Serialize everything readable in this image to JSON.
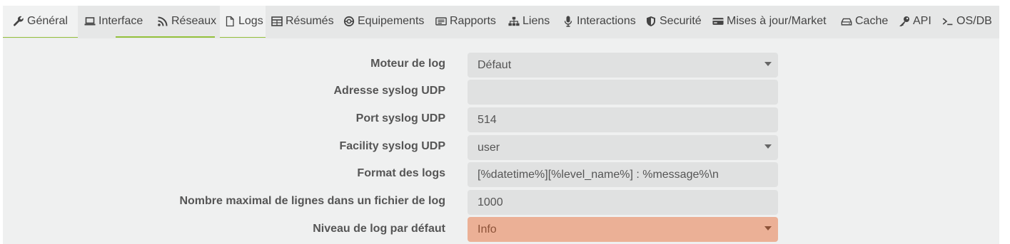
{
  "tabs": [
    {
      "label": "Général",
      "icon": "wrench-icon",
      "active": true
    },
    {
      "label": "Interface",
      "icon": "laptop-icon"
    },
    {
      "label": "Réseaux",
      "icon": "rss-icon"
    },
    {
      "label": "Logs",
      "icon": "file-icon",
      "active": true
    },
    {
      "label": "Résumés",
      "icon": "table-icon"
    },
    {
      "label": "Equipements",
      "icon": "gear-circle-icon"
    },
    {
      "label": "Rapports",
      "icon": "report-icon"
    },
    {
      "label": "Liens",
      "icon": "sitemap-icon"
    },
    {
      "label": "Interactions",
      "icon": "microphone-icon"
    },
    {
      "label": "Securité",
      "icon": "shield-icon"
    },
    {
      "label": "Mises à jour/Market",
      "icon": "credit-card-icon"
    },
    {
      "label": "Cache",
      "icon": "hdd-icon"
    },
    {
      "label": "API",
      "icon": "key-icon"
    },
    {
      "label": "OS/DB",
      "icon": "terminal-icon"
    }
  ],
  "form": {
    "log_engine": {
      "label": "Moteur de log",
      "value": "Défaut"
    },
    "syslog_address": {
      "label": "Adresse syslog UDP",
      "value": ""
    },
    "syslog_port": {
      "label": "Port syslog UDP",
      "value": "514"
    },
    "syslog_facility": {
      "label": "Facility syslog UDP",
      "value": "user"
    },
    "log_format": {
      "label": "Format des logs",
      "value": "[%datetime%][%level_name%] : %message%\\n"
    },
    "max_lines": {
      "label": "Nombre maximal de lignes dans un fichier de log",
      "value": "1000"
    },
    "default_level": {
      "label": "Niveau de log par défaut",
      "value": "Info"
    }
  },
  "colors": {
    "accent": "#94c13c",
    "warning": "#ebb096"
  }
}
